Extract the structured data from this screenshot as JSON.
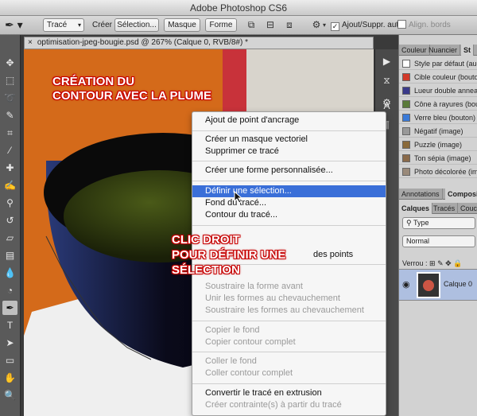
{
  "app": {
    "title": "Adobe Photoshop CS6"
  },
  "options_bar": {
    "tool_mode": "Tracé",
    "create_label": "Créer :",
    "btn_selection": "Sélection...",
    "btn_mask": "Masque",
    "btn_shape": "Forme",
    "auto_add_delete": "Ajout/Suppr. auto",
    "auto_add_checked": "✓",
    "align_edges": "Align. bords"
  },
  "document": {
    "tab_close": "×",
    "tab_title": "optimisation-jpeg-bougie.psd @ 267% (Calque 0, RVB/8#) *"
  },
  "annotations": {
    "a1_line1": "CRÉATION DU",
    "a1_line2": "CONTOUR AVEC LA PLUME",
    "a2_line1": "CLIC DROIT",
    "a2_line2": "POUR DÉFINIR UNE",
    "a2_line3": "SÉLECTION"
  },
  "context_menu": {
    "items": [
      "Ajout de point d'ancrage",
      "Créer un masque vectoriel",
      "Supprimer ce tracé",
      "Créer une forme personnalisée...",
      "Définir une sélection...",
      "Fond du tracé...",
      "Contour du tracé...",
      "des points",
      "Soustraire la forme avant",
      "Unir les formes au chevauchement",
      "Soustraire les formes au chevauchement",
      "Copier le fond",
      "Copier contour complet",
      "Coller le fond",
      "Coller contour complet",
      "Convertir le tracé en extrusion",
      "Créer contrainte(s) à partir du tracé"
    ]
  },
  "right_panel": {
    "tabs_top": [
      "Couleur",
      "Nuancier",
      "St"
    ],
    "styles": [
      {
        "name": "Style par défaut (aucun)",
        "color": "#ffffff"
      },
      {
        "name": "Cible couleur (bouton)",
        "color": "#d23a2a"
      },
      {
        "name": "Lueur double anneau (",
        "color": "#3a3a8a"
      },
      {
        "name": "Cône à rayures (bouton)",
        "color": "#5a7a3a"
      },
      {
        "name": "Verre bleu (bouton)",
        "color": "#3a7ad8"
      },
      {
        "name": "Négatif (image)",
        "color": "#999999"
      },
      {
        "name": "Puzzle (image)",
        "color": "#8a6a3a"
      },
      {
        "name": "Ton sépia (image)",
        "color": "#8a6a4a"
      },
      {
        "name": "Photo décolorée (image)",
        "color": "#9a8a7a"
      }
    ],
    "tabs_mid": [
      "Annotations",
      "Composit"
    ],
    "tabs_layers": [
      "Calques",
      "Tracés",
      "Couch"
    ],
    "filter_select": "Type",
    "blend_mode": "Normal",
    "lock_label": "Verrou :",
    "layer_name": "Calque 0"
  },
  "colors": {
    "highlight": "#3a6fd8",
    "canvas_bg": "#d46a1a",
    "annotation": "#c00000"
  }
}
